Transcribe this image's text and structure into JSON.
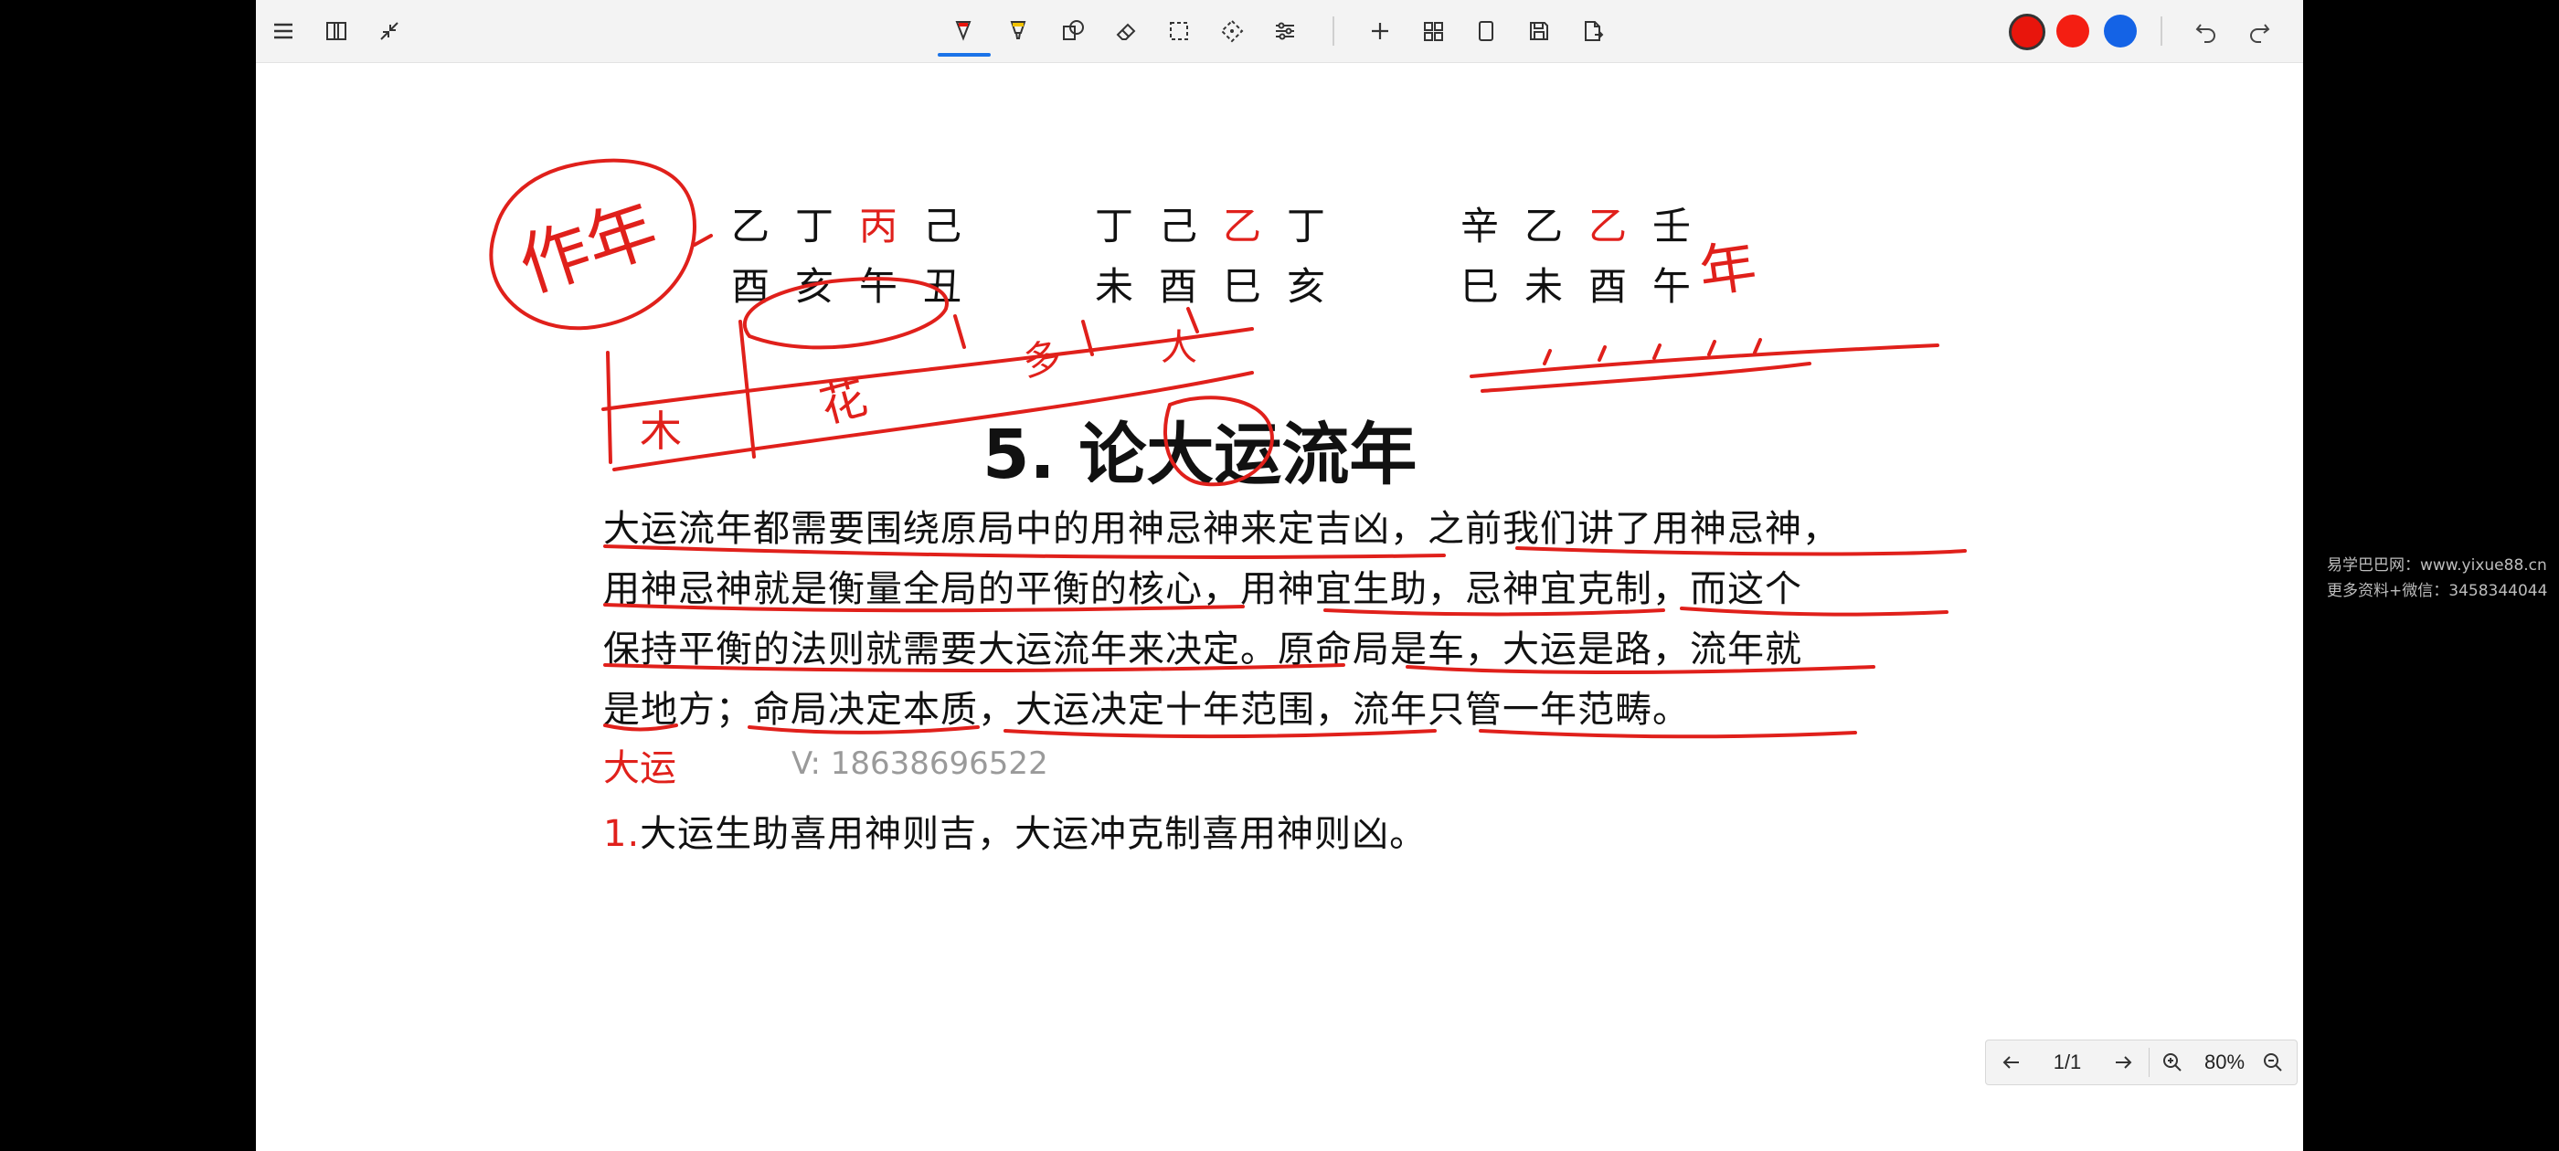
{
  "toolbar": {
    "left_icons": [
      "menu-icon",
      "book-icon",
      "collapse-icon"
    ],
    "center_icons": [
      "pen-icon",
      "highlighter-icon",
      "shapes-icon",
      "eraser-icon",
      "lasso-select-icon",
      "move-icon",
      "settings-sliders-icon",
      "add-icon",
      "grid-icon",
      "page-icon",
      "save-icon",
      "export-icon"
    ],
    "colors": [
      "#e8150c",
      "#f41e12",
      "#1463e6"
    ],
    "right_icons": [
      "undo-icon",
      "redo-icon"
    ]
  },
  "document": {
    "chart1": {
      "stems": [
        "乙",
        "丁",
        "丙",
        "己"
      ],
      "branches": [
        "酉",
        "亥",
        "午",
        "丑"
      ]
    },
    "chart2": {
      "stems": [
        "丁",
        "己",
        "乙",
        "丁"
      ],
      "branches": [
        "未",
        "酉",
        "巳",
        "亥"
      ]
    },
    "chart3": {
      "stems": [
        "辛",
        "乙",
        "乙",
        "壬"
      ],
      "branches": [
        "巳",
        "未",
        "酉",
        "午"
      ]
    },
    "title": "5. 论大运流年",
    "paragraph_lines": [
      "大运流年都需要围绕原局中的用神忌神来定吉凶，之前我们讲了用神忌神，",
      "用神忌神就是衡量全局的平衡的核心，用神宜生助，忌神宜克制，而这个",
      "保持平衡的法则就需要大运流年来决定。原命局是车，大运是路，流年就",
      "是地方；命局决定本质，大运决定十年范围，流年只管一年范畴。"
    ],
    "section_label": "大运",
    "contact": "V: 18638696522",
    "rule_number": "1.",
    "rule_text": "大运生助喜用神则吉，大运冲克制喜用神则凶。"
  },
  "annotations": {
    "circled_note": "作年",
    "right_note": "年",
    "bar_notes": [
      "木",
      "花",
      "多",
      "人"
    ]
  },
  "statusbar": {
    "page": "1/1",
    "zoom": "80%"
  },
  "watermark": {
    "line1": "易学巴巴网：www.yixue88.cn",
    "line2": "更多资料+微信：3458344044"
  }
}
